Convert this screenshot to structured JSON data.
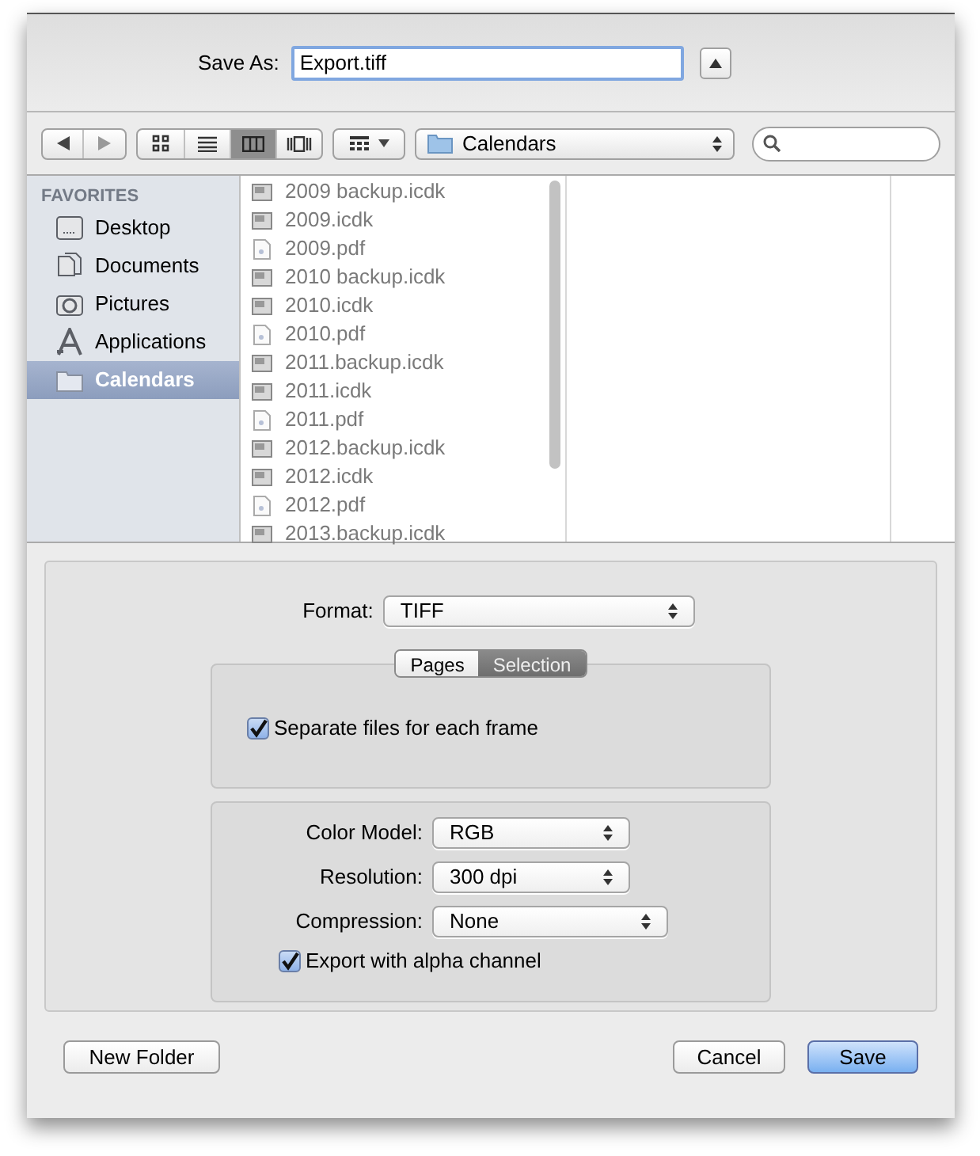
{
  "save_as": {
    "label": "Save As:",
    "value": "Export.tiff"
  },
  "toolbar": {
    "view_modes": [
      {
        "kind": "icons",
        "selected": false
      },
      {
        "kind": "list",
        "selected": false
      },
      {
        "kind": "columns",
        "selected": true
      },
      {
        "kind": "coverflow",
        "selected": false
      }
    ],
    "location": "Calendars"
  },
  "sidebar": {
    "heading": "FAVORITES",
    "items": [
      {
        "label": "Desktop",
        "kind": "desktop",
        "selected": false
      },
      {
        "label": "Documents",
        "kind": "documents",
        "selected": false
      },
      {
        "label": "Pictures",
        "kind": "camera",
        "selected": false
      },
      {
        "label": "Applications",
        "kind": "apps",
        "selected": false
      },
      {
        "label": "Calendars",
        "kind": "folder",
        "selected": true
      }
    ]
  },
  "files": [
    {
      "name": "2009 backup.icdk",
      "kind": "calendar"
    },
    {
      "name": "2009.icdk",
      "kind": "calendar"
    },
    {
      "name": "2009.pdf",
      "kind": "pdf"
    },
    {
      "name": "2010 backup.icdk",
      "kind": "calendar"
    },
    {
      "name": "2010.icdk",
      "kind": "calendar"
    },
    {
      "name": "2010.pdf",
      "kind": "pdf"
    },
    {
      "name": "2011.backup.icdk",
      "kind": "calendar"
    },
    {
      "name": "2011.icdk",
      "kind": "calendar"
    },
    {
      "name": "2011.pdf",
      "kind": "pdf"
    },
    {
      "name": "2012.backup.icdk",
      "kind": "calendar"
    },
    {
      "name": "2012.icdk",
      "kind": "calendar"
    },
    {
      "name": "2012.pdf",
      "kind": "pdf"
    },
    {
      "name": "2013.backup.icdk",
      "kind": "calendar"
    }
  ],
  "format": {
    "label": "Format:",
    "value": "TIFF"
  },
  "tabs": [
    {
      "label": "Pages",
      "selected": false
    },
    {
      "label": "Selection",
      "selected": true
    }
  ],
  "separate_files": {
    "label": "Separate files for each frame",
    "checked": true
  },
  "settings": [
    {
      "label": "Color Model:",
      "value": "RGB"
    },
    {
      "label": "Resolution:",
      "value": "300 dpi"
    },
    {
      "label": "Compression:",
      "value": "None"
    }
  ],
  "alpha": {
    "label": "Export with alpha channel",
    "checked": true
  },
  "buttons": {
    "new_folder": "New Folder",
    "cancel": "Cancel",
    "save": "Save"
  }
}
